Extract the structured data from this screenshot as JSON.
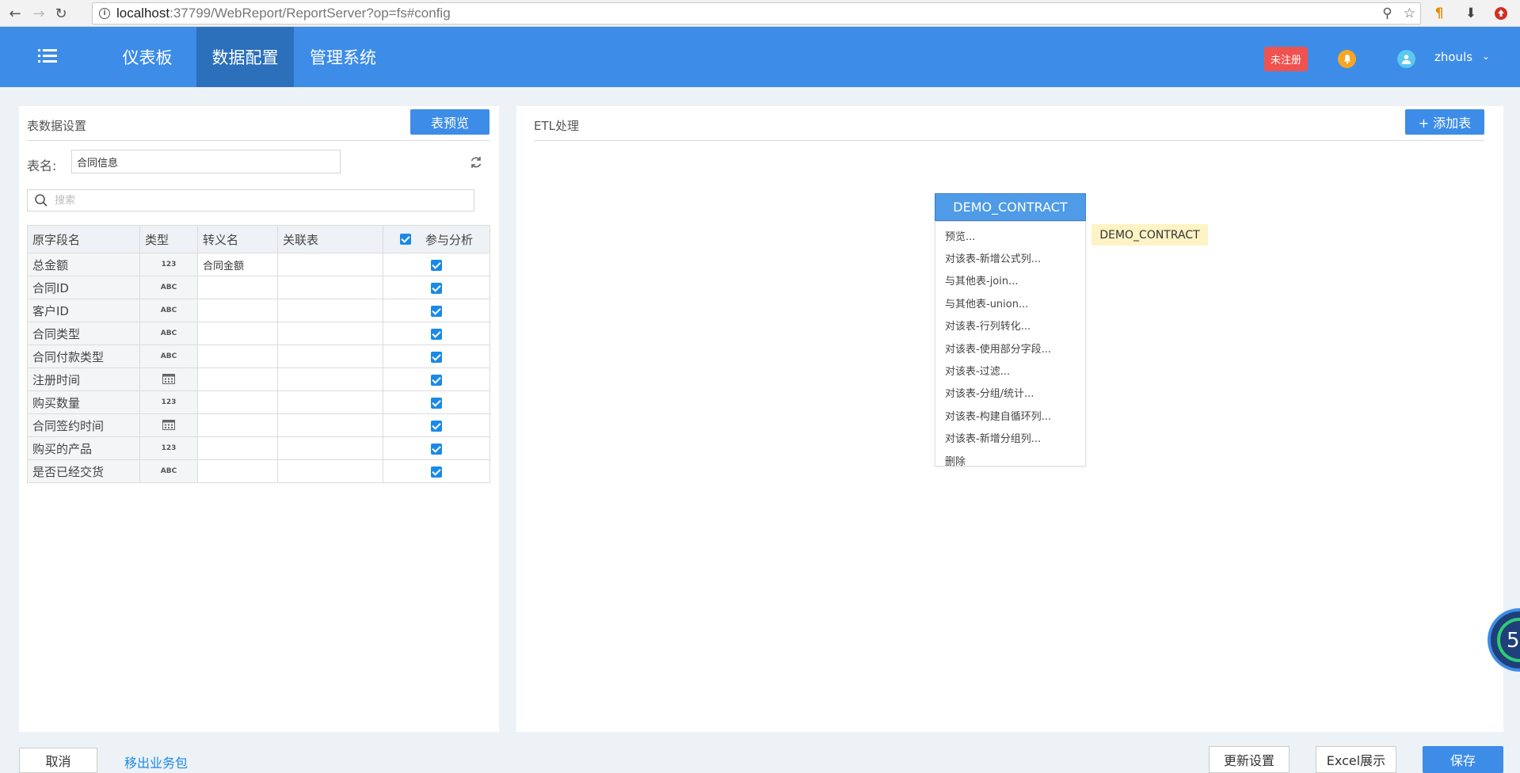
{
  "browser": {
    "url_host": "localhost",
    "url_rest": ":37799/WebReport/ReportServer?op=fs#config"
  },
  "header": {
    "tabs": [
      {
        "label": "仪表板"
      },
      {
        "label": "数据配置"
      },
      {
        "label": "管理系统"
      }
    ],
    "badge": "未注册",
    "username": "zhouls"
  },
  "left": {
    "title": "表数据设置",
    "preview_button": "表预览",
    "name_label": "表名:",
    "name_value": "合同信息",
    "search_placeholder": "搜索",
    "columns": [
      "原字段名",
      "类型",
      "转义名",
      "关联表",
      "参与分析"
    ],
    "rows": [
      {
        "name": "总金额",
        "type": "123",
        "alias": "合同金额",
        "relation": ""
      },
      {
        "name": "合同ID",
        "type": "ABC",
        "alias": "",
        "relation": ""
      },
      {
        "name": "客户ID",
        "type": "ABC",
        "alias": "",
        "relation": ""
      },
      {
        "name": "合同类型",
        "type": "ABC",
        "alias": "",
        "relation": ""
      },
      {
        "name": "合同付款类型",
        "type": "ABC",
        "alias": "",
        "relation": ""
      },
      {
        "name": "注册时间",
        "type": "date",
        "alias": "",
        "relation": ""
      },
      {
        "name": "购买数量",
        "type": "123",
        "alias": "",
        "relation": ""
      },
      {
        "name": "合同签约时间",
        "type": "date",
        "alias": "",
        "relation": ""
      },
      {
        "name": "购买的产品",
        "type": "123",
        "alias": "",
        "relation": ""
      },
      {
        "name": "是否已经交货",
        "type": "ABC",
        "alias": "",
        "relation": ""
      }
    ]
  },
  "right": {
    "title": "ETL处理",
    "add_button": "+ 添加表",
    "node_label": "DEMO_CONTRACT",
    "tooltip": "DEMO_CONTRACT",
    "menu": [
      "预览...",
      "对该表-新增公式列...",
      "与其他表-join...",
      "与其他表-union...",
      "对该表-行列转化...",
      "对该表-使用部分字段...",
      "对该表-过滤...",
      "对该表-分组/统计...",
      "对该表-构建自循环列...",
      "对该表-新增分组列...",
      "删除"
    ]
  },
  "footer": {
    "cancel": "取消",
    "move_out": "移出业务包",
    "update": "更新设置",
    "excel": "Excel展示",
    "save": "保存"
  },
  "widget_number": "5",
  "colors": {
    "header_blue": "#3d8ce8",
    "active_tab": "#2c6fbb",
    "badge_red": "#ef5350",
    "bell_orange": "#f5a623"
  }
}
